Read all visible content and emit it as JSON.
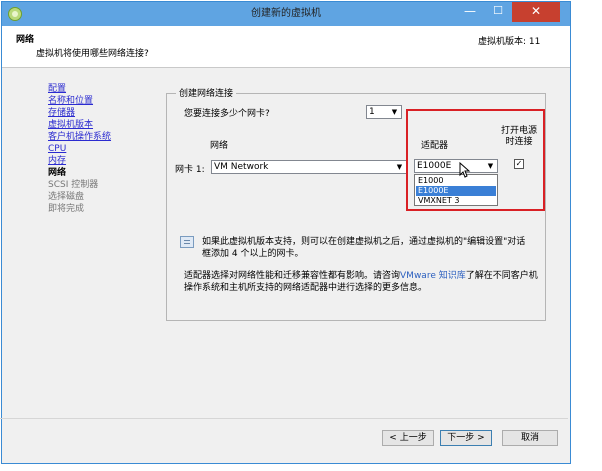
{
  "window": {
    "title": "创建新的虚拟机"
  },
  "header": {
    "title": "网络",
    "subtitle": "虚拟机将使用哪些网络连接?",
    "version": "虚拟机版本: 11"
  },
  "sidebar": {
    "items": [
      {
        "label": "配置",
        "state": "link"
      },
      {
        "label": "名称和位置",
        "state": "link"
      },
      {
        "label": "存储器",
        "state": "link"
      },
      {
        "label": "虚拟机版本",
        "state": "link"
      },
      {
        "label": "客户机操作系统",
        "state": "link"
      },
      {
        "label": "CPU",
        "state": "link"
      },
      {
        "label": "内存",
        "state": "link"
      },
      {
        "label": "网络",
        "state": "current"
      },
      {
        "label": "SCSI 控制器",
        "state": "disabled"
      },
      {
        "label": "选择磁盘",
        "state": "disabled"
      },
      {
        "label": "即将完成",
        "state": "disabled"
      }
    ]
  },
  "network": {
    "group_label": "创建网络连接",
    "question": "您要连接多少个网卡?",
    "nic_count": "1",
    "col_network": "网络",
    "col_adapter": "适配器",
    "col_power": [
      "打开电源",
      "时连接"
    ],
    "nic1_label": "网卡 1:",
    "network_value": "VM Network",
    "adapter_value": "E1000E",
    "power_checked": "✓",
    "adapter_options": [
      "E1000",
      "E1000E",
      "VMXNET 3"
    ]
  },
  "info": {
    "text": "如果此虚拟机版本支持，则可以在创建虚拟机之后，通过虚拟机的\"编辑设置\"对话框添加 4 个以上的网卡。"
  },
  "note": {
    "before": "适配器选择对网络性能和迁移兼容性都有影响。请咨询",
    "link": "VMware 知识库",
    "after": "了解在不同客户机操作系统和主机所支持的网络适配器中进行选择的更多信息。"
  },
  "buttons": {
    "back": "< 上一步",
    "next": "下一步 >",
    "cancel": "取消"
  },
  "colors": {
    "titlebar": "#5fa4e2",
    "highlight": "#d92025",
    "link": "#2b2bd0",
    "selection": "#3a7fd6"
  }
}
